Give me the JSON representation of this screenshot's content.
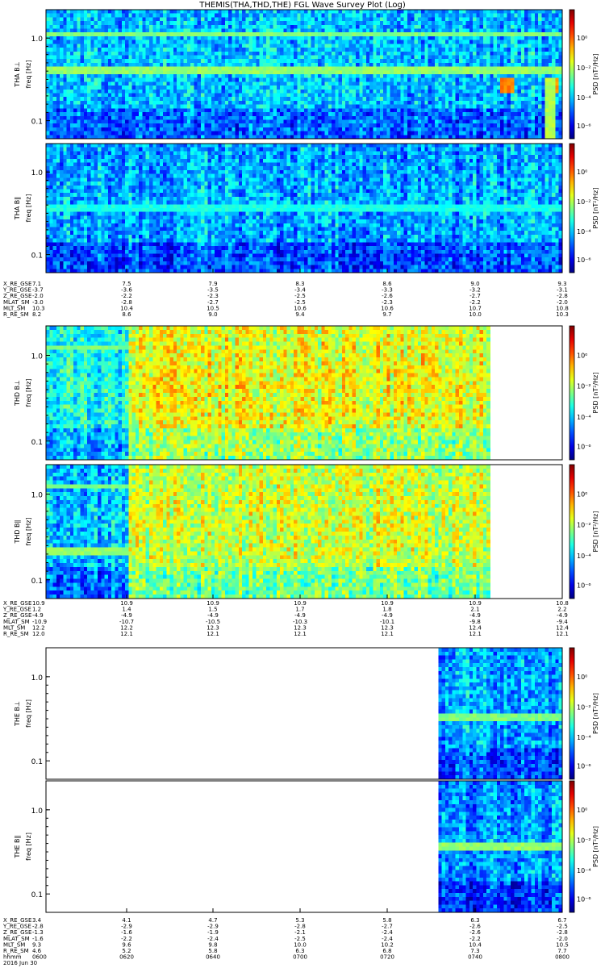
{
  "title": "THEMIS(THA,THD,THE) FGL Wave Survey Plot (Log)",
  "colors": {
    "panel_border": "#000000",
    "background": "#ffffff"
  },
  "chart_data": [
    {
      "type": "heatmap",
      "panel": "THA BL",
      "ylabel_top": "THA B⊥",
      "ylabel_bottom": "freq [Hz]",
      "colorbar_label": "PSD [nT²/Hz]",
      "yticks": [
        "1.0",
        "0.1"
      ],
      "yscale": "log",
      "cbar_ticks": [
        "10⁰",
        "10⁻²",
        "10⁻⁴",
        "10⁻⁶"
      ],
      "x_fill": [
        0,
        1
      ],
      "baseline": 0.32,
      "events": [
        {
          "x0": 0.88,
          "x1": 0.905,
          "y0": 0.34,
          "y1": 0.47,
          "level": 0.75
        },
        {
          "x0": 0.965,
          "x1": 0.99,
          "y0": 0.34,
          "y1": 0.48,
          "level": 0.72
        },
        {
          "x0": 0.97,
          "x1": 0.985,
          "y0": 0.0,
          "y1": 0.48,
          "level": 0.55
        }
      ],
      "bands": [
        {
          "y": 0.51,
          "h": 0.04,
          "level": 0.52
        },
        {
          "y": 0.78,
          "h": 0.05,
          "level": 0.5
        }
      ]
    },
    {
      "type": "heatmap",
      "panel": "THA Bpar",
      "ylabel_top": "THA B∥",
      "ylabel_bottom": "freq [Hz]",
      "colorbar_label": "PSD [nT²/Hz]",
      "yticks": [
        "1.0",
        "0.1"
      ],
      "yscale": "log",
      "cbar_ticks": [
        "10⁰",
        "10⁻²",
        "10⁻⁴",
        "10⁻⁶"
      ],
      "x_fill": [
        0,
        1
      ],
      "baseline": 0.3,
      "events": [],
      "bands": [
        {
          "y": 0.48,
          "h": 0.04,
          "level": 0.4
        }
      ]
    },
    {
      "type": "heatmap",
      "panel": "THD BL",
      "ylabel_top": "THD B⊥",
      "ylabel_bottom": "freq [Hz]",
      "colorbar_label": "PSD [nT²/Hz]",
      "yticks": [
        "1.0",
        "0.1"
      ],
      "yscale": "log",
      "cbar_ticks": [
        "10⁰",
        "10⁻²",
        "10⁻⁴",
        "10⁻⁶"
      ],
      "x_fill": [
        0,
        0.86
      ],
      "baseline": 0.62,
      "early_end": 0.16,
      "early_level": 0.4,
      "events": [],
      "bands": [
        {
          "y": 0.81,
          "h": 0.03,
          "level": 0.5,
          "x1": 0.16
        }
      ]
    },
    {
      "type": "heatmap",
      "panel": "THD Bpar",
      "ylabel_top": "THD B∥",
      "ylabel_bottom": "freq [Hz]",
      "colorbar_label": "PSD [nT²/Hz]",
      "yticks": [
        "1.0",
        "0.1"
      ],
      "yscale": "log",
      "cbar_ticks": [
        "10⁰",
        "10⁻²",
        "10⁻⁴",
        "10⁻⁶"
      ],
      "x_fill": [
        0,
        0.86
      ],
      "baseline": 0.58,
      "early_end": 0.16,
      "early_level": 0.32,
      "events": [],
      "bands": [
        {
          "y": 0.33,
          "h": 0.05,
          "level": 0.52,
          "x1": 0.16
        },
        {
          "y": 0.81,
          "h": 0.03,
          "level": 0.5,
          "x1": 0.16
        }
      ]
    },
    {
      "type": "heatmap",
      "panel": "THE BL",
      "ylabel_top": "THE B⊥",
      "ylabel_bottom": "freq [Hz]",
      "colorbar_label": "PSD [nT²/Hz]",
      "yticks": [
        "1.0",
        "0.1"
      ],
      "yscale": "log",
      "cbar_ticks": [
        "10⁰",
        "10⁻²",
        "10⁻⁴",
        "10⁻⁶"
      ],
      "x_fill": [
        0.76,
        1
      ],
      "baseline": 0.3,
      "events": [],
      "bands": [
        {
          "y": 0.43,
          "h": 0.06,
          "level": 0.5
        }
      ]
    },
    {
      "type": "heatmap",
      "panel": "THE Bpar",
      "ylabel_top": "THE B∥",
      "ylabel_bottom": "freq [Hz]",
      "colorbar_label": "PSD [nT²/Hz]",
      "yticks": [
        "1.0",
        "0.1"
      ],
      "yscale": "log",
      "cbar_ticks": [
        "10⁰",
        "10⁻²",
        "10⁻⁴",
        "10⁻⁶"
      ],
      "x_fill": [
        0.76,
        1
      ],
      "baseline": 0.28,
      "events": [],
      "bands": [
        {
          "y": 0.46,
          "h": 0.06,
          "level": 0.52
        }
      ]
    }
  ],
  "ephemeris": [
    {
      "probe": "THA",
      "rows": [
        {
          "label": "X_RE_GSE",
          "values": [
            "7.1",
            "7.5",
            "7.9",
            "8.3",
            "8.6",
            "9.0",
            "9.3"
          ]
        },
        {
          "label": "Y_RE_GSE",
          "values": [
            "-3.7",
            "-3.6",
            "-3.5",
            "-3.4",
            "-3.3",
            "-3.2",
            "-3.1"
          ]
        },
        {
          "label": "Z_RE_GSE",
          "values": [
            "-2.0",
            "-2.2",
            "-2.3",
            "-2.5",
            "-2.6",
            "-2.7",
            "-2.8"
          ]
        },
        {
          "label": "MLAT_SM",
          "values": [
            "-3.0",
            "-2.8",
            "-2.7",
            "-2.5",
            "-2.3",
            "-2.2",
            "-2.0"
          ]
        },
        {
          "label": "MLT_SM",
          "values": [
            "10.3",
            "10.4",
            "10.5",
            "10.6",
            "10.6",
            "10.7",
            "10.8"
          ]
        },
        {
          "label": "R_RE_SM",
          "values": [
            "8.2",
            "8.6",
            "9.0",
            "9.4",
            "9.7",
            "10.0",
            "10.3"
          ]
        }
      ]
    },
    {
      "probe": "THD",
      "rows": [
        {
          "label": "X_RE_GSE",
          "values": [
            "10.9",
            "10.9",
            "10.9",
            "10.9",
            "10.9",
            "10.9",
            "10.8"
          ]
        },
        {
          "label": "Y_RE_GSE",
          "values": [
            "1.2",
            "1.4",
            "1.5",
            "1.7",
            "1.8",
            "2.1",
            "2.2"
          ]
        },
        {
          "label": "Z_RE_GSE",
          "values": [
            "-4.9",
            "-4.9",
            "-4.9",
            "-4.9",
            "-4.9",
            "-4.9",
            "-4.9"
          ]
        },
        {
          "label": "MLAT_SM",
          "values": [
            "-10.9",
            "-10.7",
            "-10.5",
            "-10.3",
            "-10.1",
            "-9.8",
            "-9.4"
          ]
        },
        {
          "label": "MLT_SM",
          "values": [
            "12.2",
            "12.2",
            "12.3",
            "12.3",
            "12.3",
            "12.4",
            "12.4"
          ]
        },
        {
          "label": "R_RE_SM",
          "values": [
            "12.0",
            "12.1",
            "12.1",
            "12.1",
            "12.1",
            "12.1",
            "12.1"
          ]
        }
      ]
    },
    {
      "probe": "THE",
      "rows": [
        {
          "label": "X_RE_GSE",
          "values": [
            "3.4",
            "4.1",
            "4.7",
            "5.3",
            "5.8",
            "6.3",
            "6.7"
          ]
        },
        {
          "label": "Y_RE_GSE",
          "values": [
            "-2.8",
            "-2.9",
            "-2.9",
            "-2.8",
            "-2.7",
            "-2.6",
            "-2.5"
          ]
        },
        {
          "label": "Z_RE_GSE",
          "values": [
            "-1.3",
            "-1.6",
            "-1.9",
            "-2.1",
            "-2.4",
            "-2.6",
            "-2.8"
          ]
        },
        {
          "label": "MLAT_SM",
          "values": [
            "-1.6",
            "-2.2",
            "-2.4",
            "-2.5",
            "-2.4",
            "-2.2",
            "-2.0"
          ]
        },
        {
          "label": "MLT_SM",
          "values": [
            "9.3",
            "9.6",
            "9.8",
            "10.0",
            "10.2",
            "10.4",
            "10.5"
          ]
        },
        {
          "label": "R_RE_SM",
          "values": [
            "4.6",
            "5.2",
            "5.8",
            "6.3",
            "6.8",
            "7.3",
            "7.7"
          ]
        },
        {
          "label": "hhmm",
          "values": [
            "0600",
            "0620",
            "0640",
            "0700",
            "0720",
            "0740",
            "0800"
          ]
        },
        {
          "label": "2016 Jun 30",
          "values": []
        }
      ]
    }
  ]
}
